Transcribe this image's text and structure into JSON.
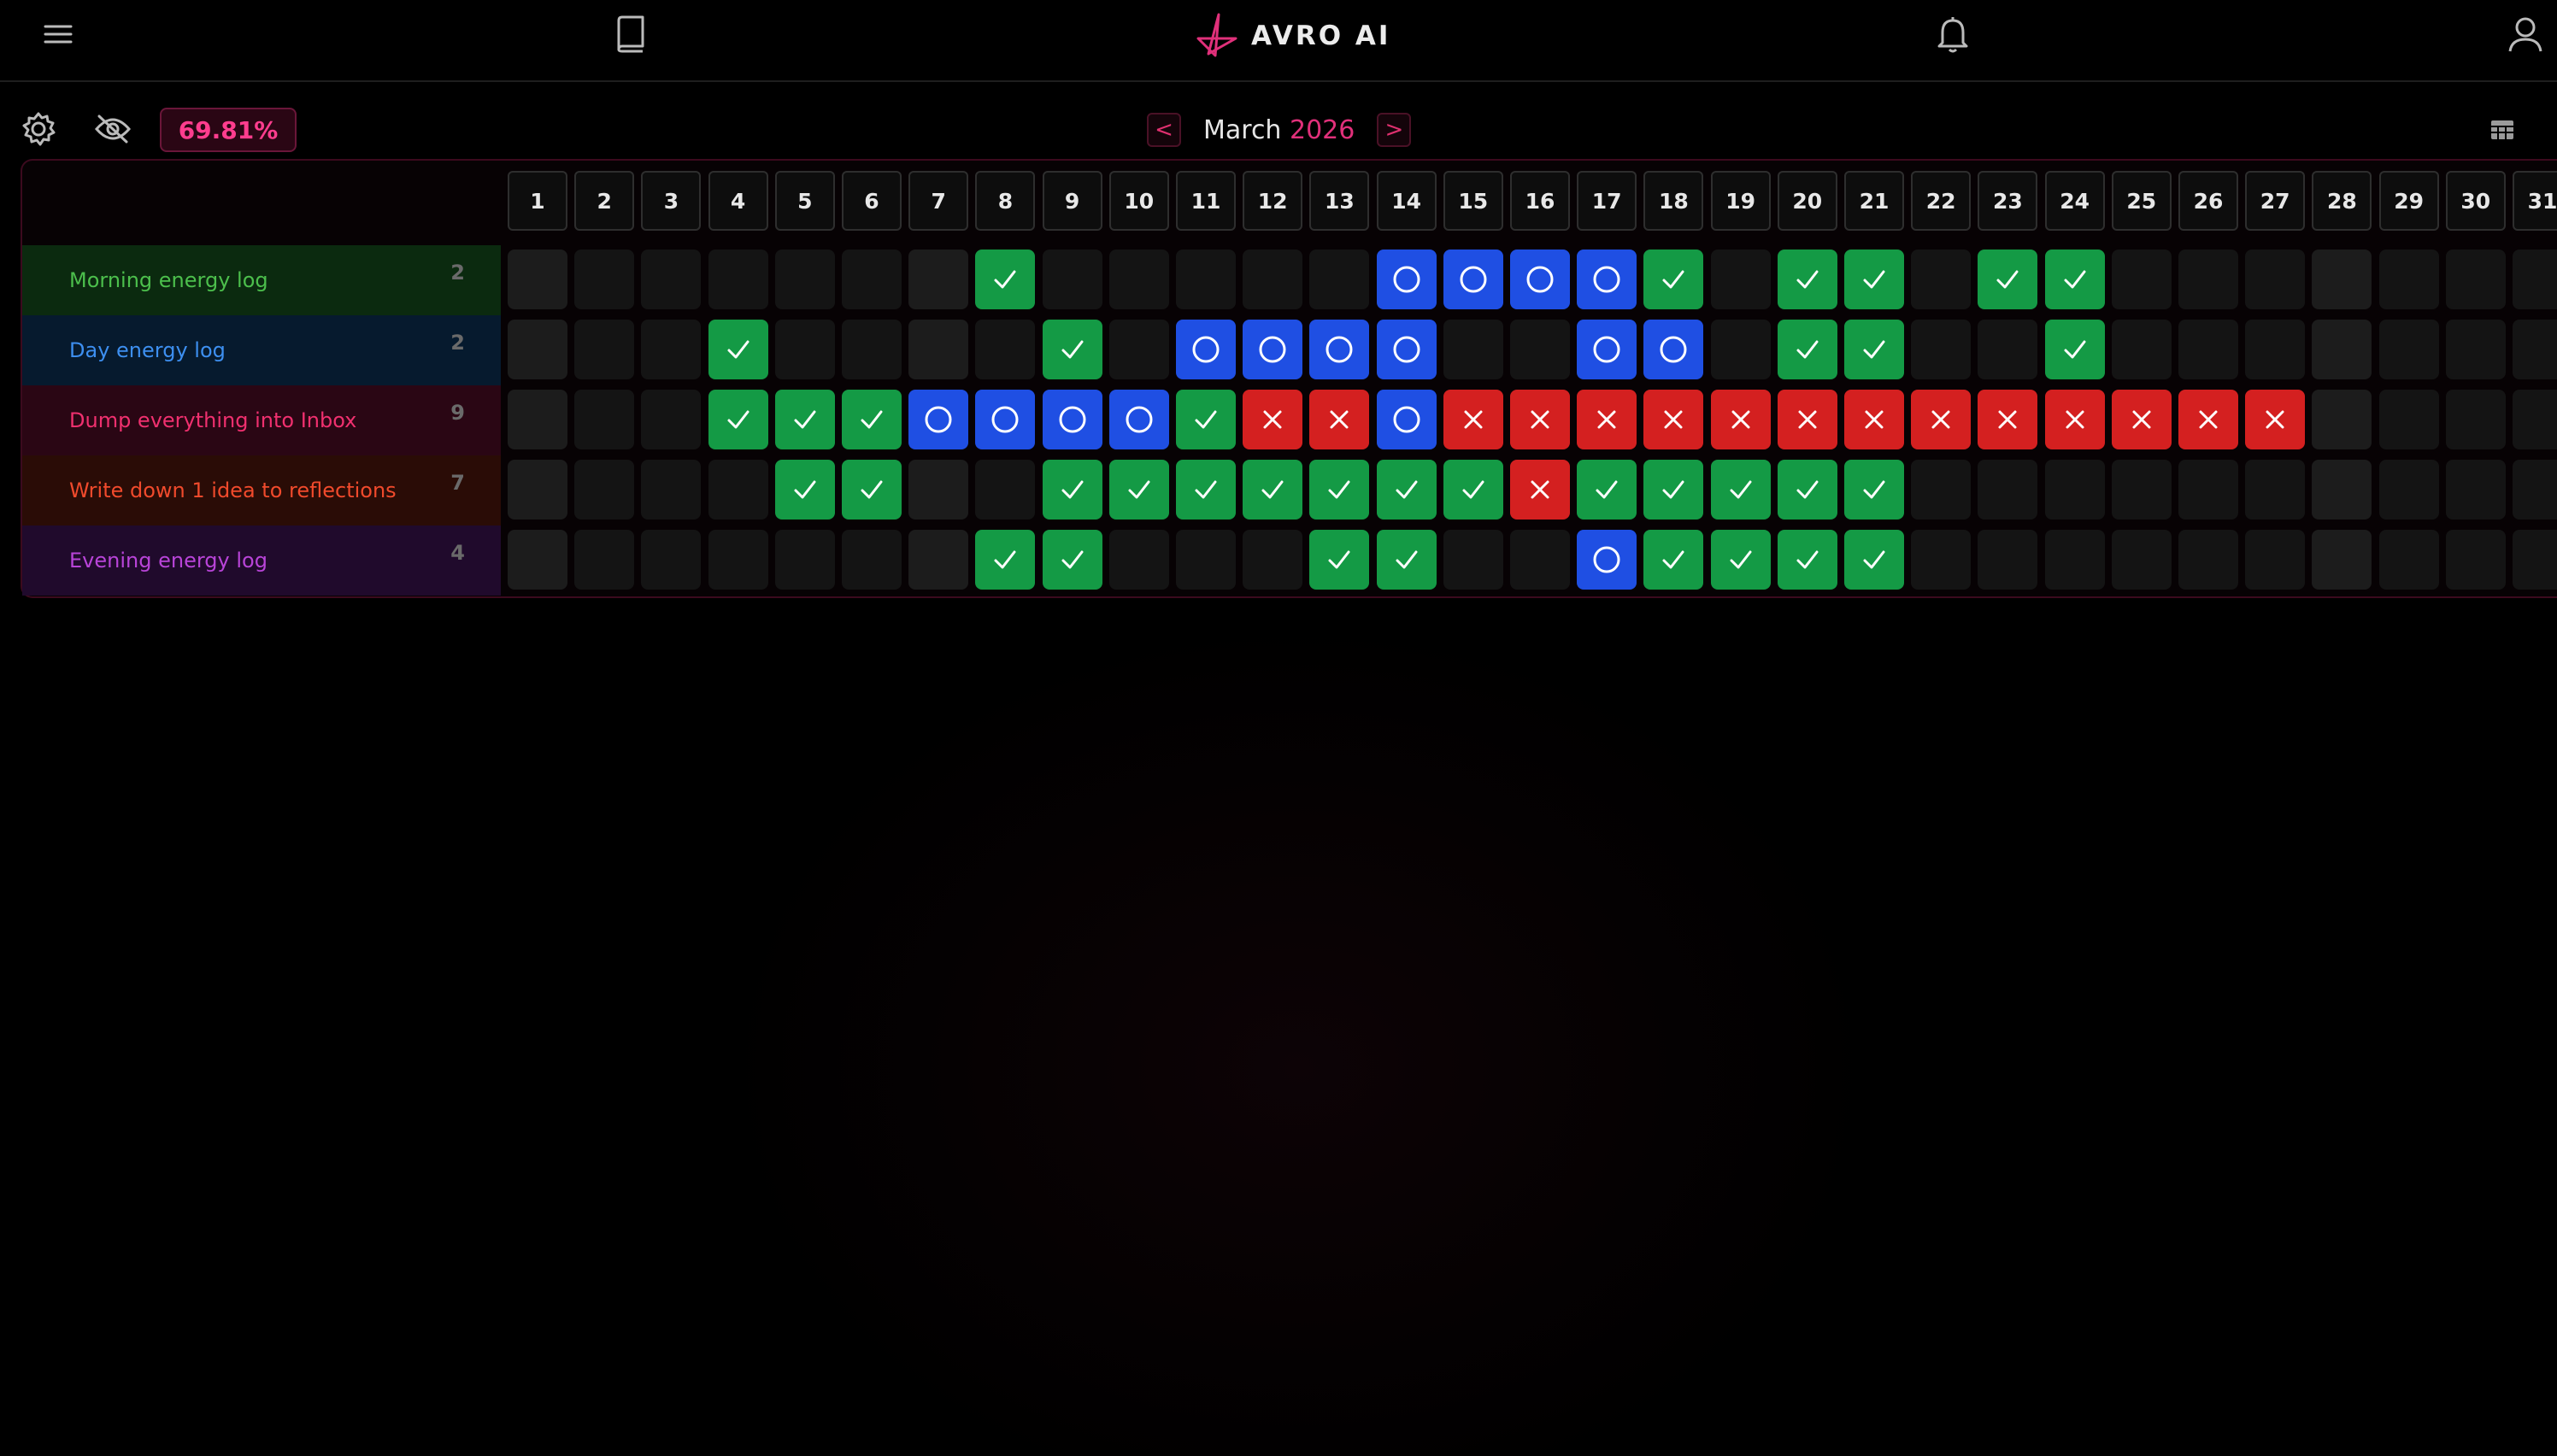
{
  "app": {
    "brand": "AVRO AI"
  },
  "toolbar": {
    "percentage": "69.81%"
  },
  "calendar": {
    "month": "March",
    "year": "2026",
    "prev_label": "<",
    "next_label": ">"
  },
  "colors": {
    "done": "#149a45",
    "pending": "#1f4fe3",
    "fail": "#d42020",
    "accent": "#e0307a"
  },
  "days": [
    "1",
    "2",
    "3",
    "4",
    "5",
    "6",
    "7",
    "8",
    "9",
    "10",
    "11",
    "12",
    "13",
    "14",
    "15",
    "16",
    "17",
    "18",
    "19",
    "20",
    "21",
    "22",
    "23",
    "24",
    "25",
    "26",
    "27",
    "28",
    "29",
    "30",
    "31"
  ],
  "habits": [
    {
      "name": "Morning energy log",
      "count": "2",
      "text_color": "#4cbf4c",
      "bg_color": "#0b2a0f",
      "states": [
        "e",
        "e",
        "e",
        "e",
        "e",
        "e",
        "e",
        "d",
        "e",
        "e",
        "e",
        "e",
        "e",
        "p",
        "p",
        "p",
        "p",
        "d",
        "e",
        "d",
        "d",
        "e",
        "d",
        "d",
        "e",
        "e",
        "e",
        "e",
        "e",
        "e",
        "e"
      ]
    },
    {
      "name": "Day energy log",
      "count": "2",
      "text_color": "#3d8ff0",
      "bg_color": "#061a2e",
      "states": [
        "e",
        "e",
        "e",
        "d",
        "e",
        "e",
        "e",
        "e",
        "d",
        "e",
        "p",
        "p",
        "p",
        "p",
        "e",
        "e",
        "p",
        "p",
        "e",
        "d",
        "d",
        "e",
        "e",
        "d",
        "e",
        "e",
        "e",
        "e",
        "e",
        "e",
        "e"
      ]
    },
    {
      "name": "Dump everything into Inbox",
      "count": "9",
      "text_color": "#f0306f",
      "bg_color": "#2a0614",
      "states": [
        "e",
        "e",
        "e",
        "d",
        "d",
        "d",
        "p",
        "p",
        "p",
        "p",
        "d",
        "f",
        "f",
        "p",
        "f",
        "f",
        "f",
        "f",
        "f",
        "f",
        "f",
        "f",
        "f",
        "f",
        "f",
        "f",
        "f",
        "e",
        "e",
        "e",
        "e"
      ]
    },
    {
      "name": "Write down 1 idea to reflections",
      "count": "7",
      "text_color": "#f04a2c",
      "bg_color": "#2a0c06",
      "states": [
        "e",
        "e",
        "e",
        "e",
        "d",
        "d",
        "e",
        "e",
        "d",
        "d",
        "d",
        "d",
        "d",
        "d",
        "d",
        "f",
        "d",
        "d",
        "d",
        "d",
        "d",
        "e",
        "e",
        "e",
        "e",
        "e",
        "e",
        "e",
        "e",
        "e",
        "e"
      ]
    },
    {
      "name": "Evening energy log",
      "count": "4",
      "text_color": "#b844d8",
      "bg_color": "#200a2c",
      "states": [
        "e",
        "e",
        "e",
        "e",
        "e",
        "e",
        "e",
        "d",
        "d",
        "e",
        "e",
        "e",
        "d",
        "d",
        "e",
        "e",
        "p",
        "d",
        "d",
        "d",
        "d",
        "e",
        "e",
        "e",
        "e",
        "e",
        "e",
        "e",
        "e",
        "e",
        "e"
      ]
    }
  ]
}
